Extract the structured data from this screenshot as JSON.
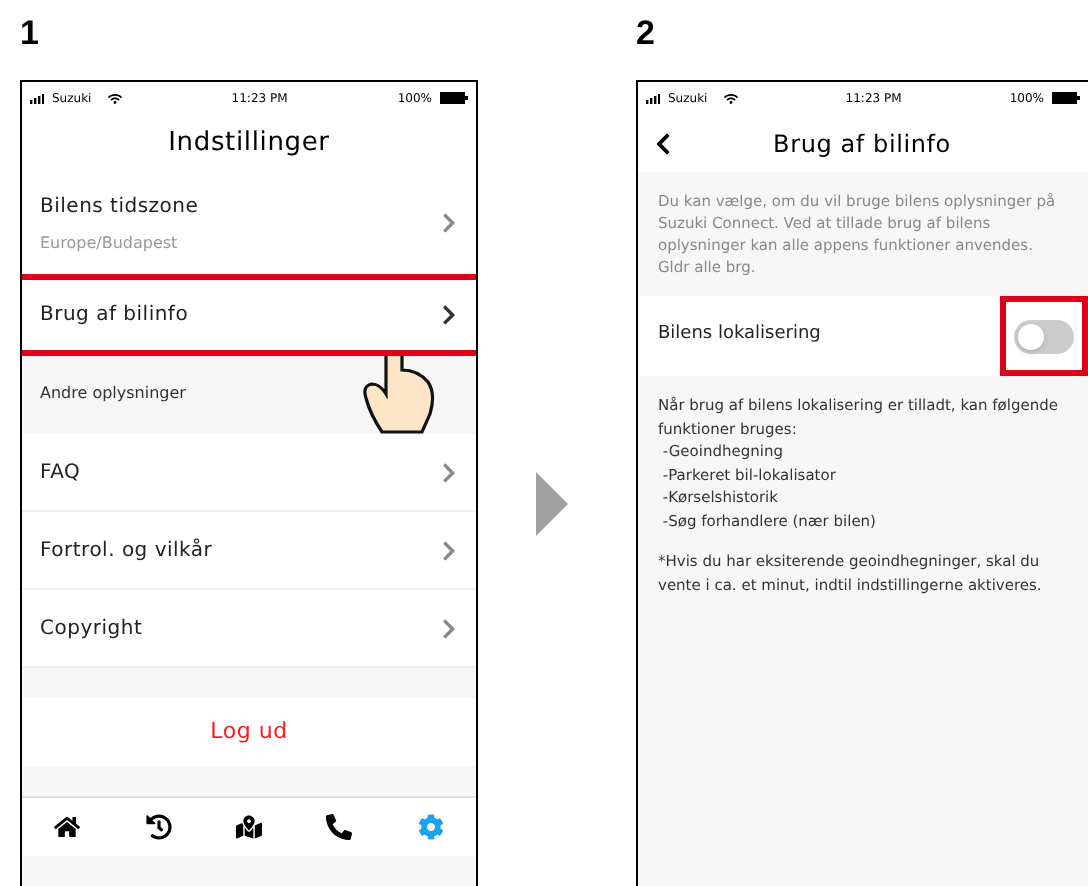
{
  "steps": [
    {
      "number": "1",
      "status_bar": {
        "carrier": "Suzuki",
        "time": "11:23 PM",
        "battery": "100%"
      },
      "title": "Indstillinger",
      "rows": [
        {
          "kind": "item",
          "label": "Bilens tidszone",
          "sublabel": "Europe/Budapest",
          "highlighted": false
        },
        {
          "kind": "item",
          "label": "Brug af bilinfo",
          "highlighted": true
        },
        {
          "kind": "section",
          "label": "Andre oplysninger"
        },
        {
          "kind": "item",
          "label": "FAQ",
          "highlighted": false
        },
        {
          "kind": "item",
          "label": "Fortrol. og vilkår",
          "highlighted": false
        },
        {
          "kind": "item",
          "label": "Copyright",
          "highlighted": false
        },
        {
          "kind": "spacer"
        },
        {
          "kind": "action",
          "label": "Log ud"
        },
        {
          "kind": "spacer"
        }
      ],
      "tab_bar": [
        {
          "selected": false
        },
        {
          "selected": false
        },
        {
          "selected": false
        },
        {
          "selected": false
        },
        {
          "selected": true
        }
      ]
    },
    {
      "number": "2",
      "status_bar": {
        "carrier": "Suzuki",
        "time": "11:23 PM",
        "battery": "100%"
      },
      "title": "Brug af bilinfo",
      "description": "Du kan vælge, om du vil bruge bilens oplysninger på Suzuki Connect. Ved at tillade brug af bilens oplysninger kan alle appens funktioner anvendes. Gldr alle brg.",
      "toggle": {
        "label": "Bilens lokalisering",
        "on": false,
        "highlighted": true
      },
      "info_lines": [
        "Når brug af bilens lokalisering er tilladt, kan følgende funktioner bruges:",
        " -Geoindhegning",
        " -Parkeret bil-lokalisator",
        " -Kørselshistorik",
        " -Søg forhandlere (nær bilen)"
      ],
      "note": "*Hvis du har eksiterende geoindhegninger, skal du vente i ca. et minut, indtil indstillingerne aktiveres."
    }
  ]
}
